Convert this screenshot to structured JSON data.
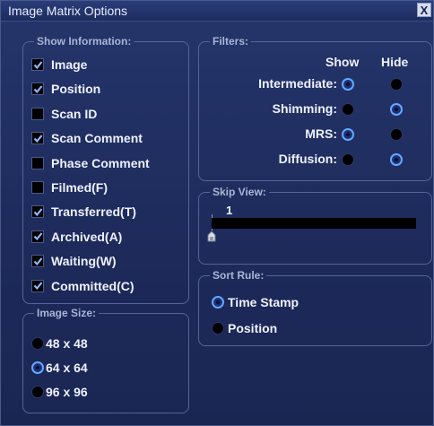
{
  "window": {
    "title": "Image Matrix Options",
    "close_glyph": "X"
  },
  "show_information": {
    "title": "Show Information:",
    "items": [
      {
        "label": "Image",
        "checked": true
      },
      {
        "label": "Position",
        "checked": true
      },
      {
        "label": "Scan ID",
        "checked": false
      },
      {
        "label": "Scan Comment",
        "checked": true
      },
      {
        "label": "Phase Comment",
        "checked": false
      },
      {
        "label": "Filmed(F)",
        "checked": false
      },
      {
        "label": "Transferred(T)",
        "checked": true
      },
      {
        "label": "Archived(A)",
        "checked": true
      },
      {
        "label": "Waiting(W)",
        "checked": true
      },
      {
        "label": "Committed(C)",
        "checked": true
      }
    ]
  },
  "image_size": {
    "title": "Image Size:",
    "options": [
      {
        "label": "48 x 48",
        "selected": false
      },
      {
        "label": "64 x 64",
        "selected": true
      },
      {
        "label": "96 x 96",
        "selected": false
      }
    ]
  },
  "filters": {
    "title": "Filters:",
    "show_label": "Show",
    "hide_label": "Hide",
    "rows": [
      {
        "label": "Intermediate:",
        "value": "show"
      },
      {
        "label": "Shimming:",
        "value": "hide"
      },
      {
        "label": "MRS:",
        "value": "show"
      },
      {
        "label": "Diffusion:",
        "value": "hide"
      }
    ]
  },
  "skip_view": {
    "title": "Skip View:",
    "value": "1"
  },
  "sort_rule": {
    "title": "Sort Rule:",
    "options": [
      {
        "label": "Time Stamp",
        "selected": true
      },
      {
        "label": "Position",
        "selected": false
      }
    ]
  },
  "colors": {
    "background": "#1e2b5c",
    "accent": "#64a9ff",
    "group_border": "#55659a"
  }
}
